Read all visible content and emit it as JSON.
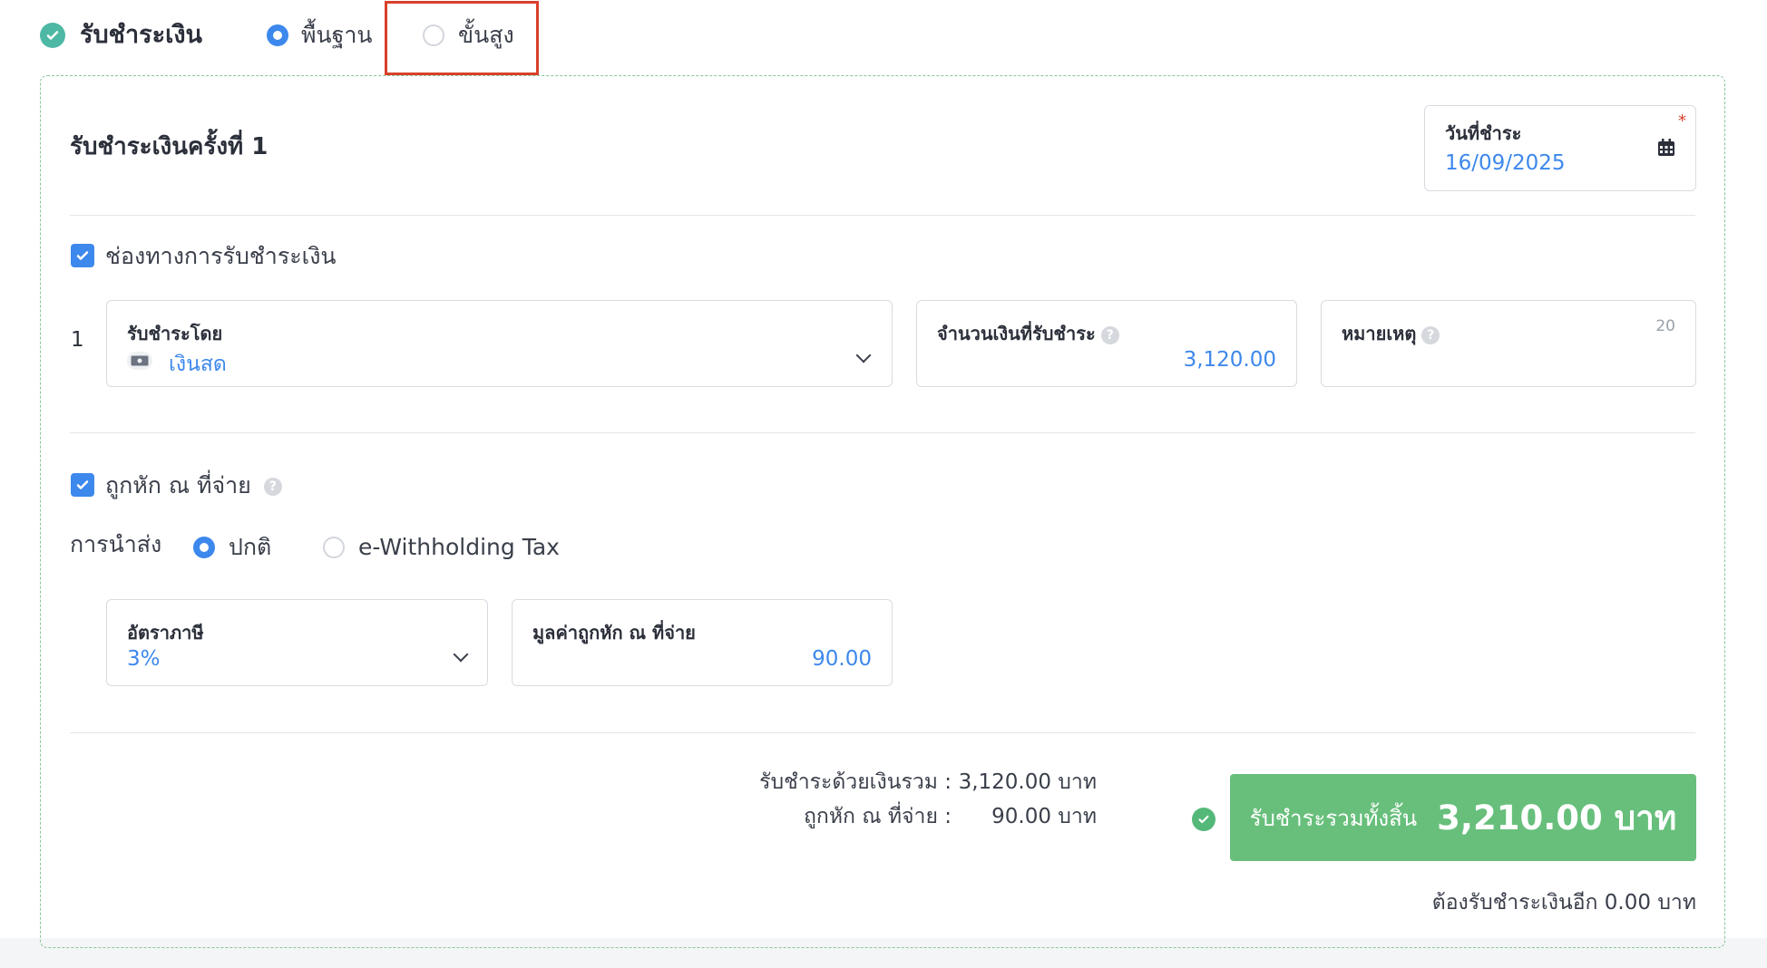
{
  "header": {
    "title": "รับชำระเงิน",
    "modes": [
      {
        "label": "พื้นฐาน",
        "selected": true
      },
      {
        "label": "ขั้นสูง",
        "selected": false
      }
    ]
  },
  "payment": {
    "section_title": "รับชำระเงินครั้งที่ 1",
    "date": {
      "label": "วันที่ชำระ",
      "value": "16/09/2025",
      "required_mark": "*",
      "icon": "calendar-icon"
    },
    "channel": {
      "checkbox_label": "ช่องทางการรับชำระเงิน",
      "checked": true,
      "row_number": "1",
      "method": {
        "label": "รับชำระโดย",
        "value": "เงินสด",
        "icon": "cash-icon"
      },
      "amount": {
        "label": "จำนวนเงินที่รับชำระ",
        "help": "?",
        "value": "3,120.00"
      },
      "note": {
        "label": "หมายเหตุ",
        "help": "?",
        "char_limit": "20"
      }
    },
    "withholding": {
      "checkbox_label": "ถูกหัก ณ ที่จ่าย",
      "checked": true,
      "help": "?",
      "delivery_label": "การนำส่ง",
      "delivery_options": [
        {
          "label": "ปกติ",
          "selected": true
        },
        {
          "label": "e-Withholding Tax",
          "selected": false
        }
      ],
      "rate": {
        "label": "อัตราภาษี",
        "value": "3%"
      },
      "amount": {
        "label": "มูลค่าถูกหัก ณ ที่จ่าย",
        "value": "90.00"
      }
    }
  },
  "summary": {
    "paid_label": "รับชำระด้วยเงินรวม :",
    "paid_value": "3,120.00 บาท",
    "withheld_label": "ถูกหัก ณ ที่จ่าย :",
    "withheld_value": "90.00 บาท",
    "total_label": "รับชำระรวมทั้งสิ้น",
    "total_value": "3,210.00 บาท",
    "remaining": "ต้องรับชำระเงินอีก 0.00 บาท"
  },
  "colors": {
    "accent": "#3d88ec",
    "success": "#67bf7b",
    "highlight": "#d9402b"
  }
}
